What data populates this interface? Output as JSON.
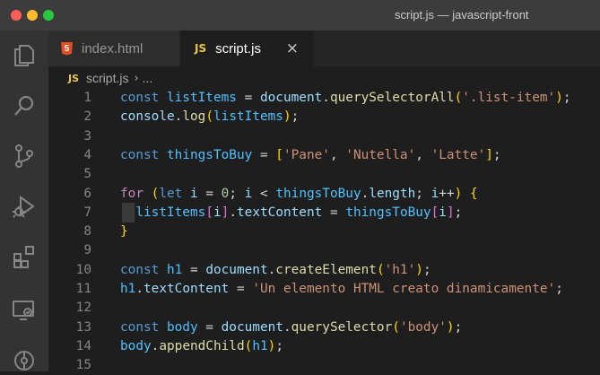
{
  "window": {
    "title": "script.js — javascript-front"
  },
  "activity_bar": {
    "icons": [
      "explorer-icon",
      "search-icon",
      "source-control-icon",
      "run-debug-icon",
      "extensions-icon",
      "remote-explorer-icon",
      "git-graph-icon"
    ]
  },
  "tabs": [
    {
      "label": "index.html",
      "icon": "html-file-icon",
      "active": false
    },
    {
      "label": "script.js",
      "icon": "js-file-icon",
      "active": true,
      "close": "×"
    }
  ],
  "breadcrumb": {
    "badge": "JS",
    "file": "script.js",
    "separator": "›",
    "more": "..."
  },
  "file_badge": "JS",
  "code_lines": [
    {
      "n": "1",
      "tokens": [
        [
          "keyword",
          "const "
        ],
        [
          "constvar",
          "listItems"
        ],
        [
          "plain",
          " = "
        ],
        [
          "variable",
          "document"
        ],
        [
          "plain",
          "."
        ],
        [
          "function",
          "querySelectorAll"
        ],
        [
          "bracket1",
          "("
        ],
        [
          "string",
          "'.list-item'"
        ],
        [
          "bracket1",
          ")"
        ],
        [
          "plain",
          ";"
        ]
      ]
    },
    {
      "n": "2",
      "tokens": [
        [
          "variable",
          "console"
        ],
        [
          "plain",
          "."
        ],
        [
          "function",
          "log"
        ],
        [
          "bracket1",
          "("
        ],
        [
          "constvar",
          "listItems"
        ],
        [
          "bracket1",
          ")"
        ],
        [
          "plain",
          ";"
        ]
      ]
    },
    {
      "n": "3",
      "tokens": []
    },
    {
      "n": "4",
      "tokens": [
        [
          "keyword",
          "const "
        ],
        [
          "constvar",
          "thingsToBuy"
        ],
        [
          "plain",
          " = "
        ],
        [
          "bracket1",
          "["
        ],
        [
          "string",
          "'Pane'"
        ],
        [
          "plain",
          ", "
        ],
        [
          "string",
          "'Nutella'"
        ],
        [
          "plain",
          ", "
        ],
        [
          "string",
          "'Latte'"
        ],
        [
          "bracket1",
          "]"
        ],
        [
          "plain",
          ";"
        ]
      ]
    },
    {
      "n": "5",
      "tokens": []
    },
    {
      "n": "6",
      "tokens": [
        [
          "control",
          "for "
        ],
        [
          "bracket1",
          "("
        ],
        [
          "keyword",
          "let "
        ],
        [
          "variable",
          "i"
        ],
        [
          "plain",
          " = "
        ],
        [
          "number",
          "0"
        ],
        [
          "plain",
          "; "
        ],
        [
          "variable",
          "i"
        ],
        [
          "plain",
          " < "
        ],
        [
          "constvar",
          "thingsToBuy"
        ],
        [
          "plain",
          "."
        ],
        [
          "variable",
          "length"
        ],
        [
          "plain",
          "; "
        ],
        [
          "variable",
          "i"
        ],
        [
          "plain",
          "++"
        ],
        [
          "bracket1",
          ")"
        ],
        [
          "plain",
          " "
        ],
        [
          "bracket1",
          "{"
        ]
      ]
    },
    {
      "n": "7",
      "tokens": [
        [
          "plain",
          "  "
        ],
        [
          "constvar",
          "listItems"
        ],
        [
          "bracket2",
          "["
        ],
        [
          "variable",
          "i"
        ],
        [
          "bracket2",
          "]"
        ],
        [
          "plain",
          "."
        ],
        [
          "variable",
          "textContent"
        ],
        [
          "plain",
          " = "
        ],
        [
          "constvar",
          "thingsToBuy"
        ],
        [
          "bracket2",
          "["
        ],
        [
          "variable",
          "i"
        ],
        [
          "bracket2",
          "]"
        ],
        [
          "plain",
          ";"
        ]
      ],
      "indent_guide": true
    },
    {
      "n": "8",
      "tokens": [
        [
          "bracket1",
          "}"
        ]
      ]
    },
    {
      "n": "9",
      "tokens": []
    },
    {
      "n": "10",
      "tokens": [
        [
          "keyword",
          "const "
        ],
        [
          "constvar",
          "h1"
        ],
        [
          "plain",
          " = "
        ],
        [
          "variable",
          "document"
        ],
        [
          "plain",
          "."
        ],
        [
          "function",
          "createElement"
        ],
        [
          "bracket1",
          "("
        ],
        [
          "string",
          "'h1'"
        ],
        [
          "bracket1",
          ")"
        ],
        [
          "plain",
          ";"
        ]
      ]
    },
    {
      "n": "11",
      "tokens": [
        [
          "constvar",
          "h1"
        ],
        [
          "plain",
          "."
        ],
        [
          "variable",
          "textContent"
        ],
        [
          "plain",
          " = "
        ],
        [
          "string",
          "'Un elemento HTML creato dinamicamente'"
        ],
        [
          "plain",
          ";"
        ]
      ]
    },
    {
      "n": "12",
      "tokens": []
    },
    {
      "n": "13",
      "tokens": [
        [
          "keyword",
          "const "
        ],
        [
          "constvar",
          "body"
        ],
        [
          "plain",
          " = "
        ],
        [
          "variable",
          "document"
        ],
        [
          "plain",
          "."
        ],
        [
          "function",
          "querySelector"
        ],
        [
          "bracket1",
          "("
        ],
        [
          "string",
          "'body'"
        ],
        [
          "bracket1",
          ")"
        ],
        [
          "plain",
          ";"
        ]
      ]
    },
    {
      "n": "14",
      "tokens": [
        [
          "constvar",
          "body"
        ],
        [
          "plain",
          "."
        ],
        [
          "function",
          "appendChild"
        ],
        [
          "bracket1",
          "("
        ],
        [
          "constvar",
          "h1"
        ],
        [
          "bracket1",
          ")"
        ],
        [
          "plain",
          ";"
        ]
      ]
    },
    {
      "n": "15",
      "tokens": []
    }
  ],
  "colors": {
    "editor_bg": "#1e1e1e",
    "activity_bar_bg": "#333333",
    "titlebar_bg": "#3c3c3c",
    "keyword": "#569cd6",
    "string": "#ce9178",
    "function": "#dcdcaa",
    "variable": "#9cdcfe",
    "constant_variable": "#4fc1ff",
    "js_badge": "#e8c84a",
    "html_badge": "#e44d26"
  }
}
